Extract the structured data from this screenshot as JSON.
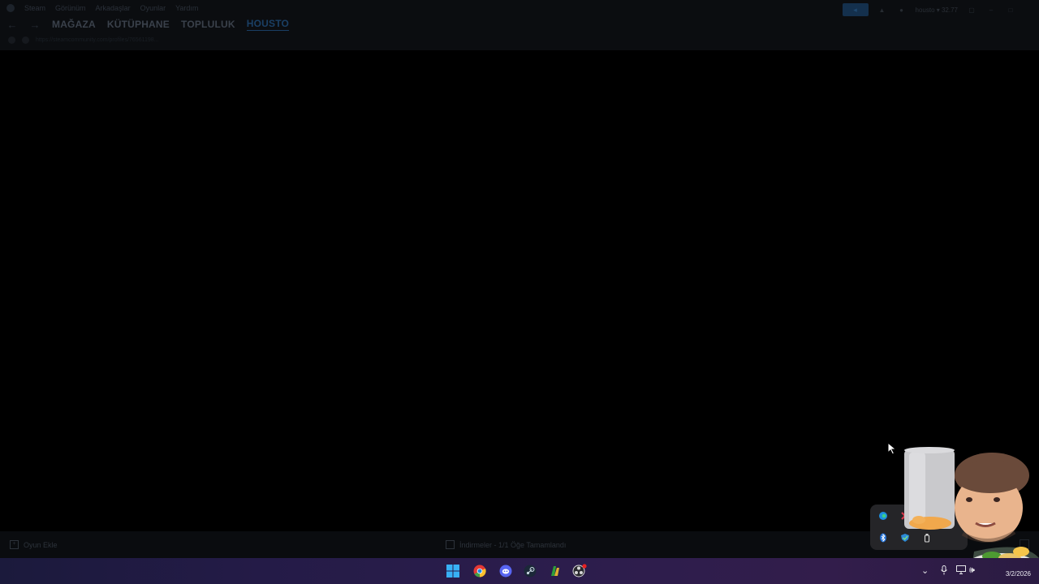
{
  "steam": {
    "menu": [
      "Steam",
      "Görünüm",
      "Arkadaşlar",
      "Oyunlar",
      "Yardım"
    ],
    "nav_tabs": [
      {
        "label": "MAĞAZA"
      },
      {
        "label": "KÜTÜPHANE"
      },
      {
        "label": "TOPLULUK"
      },
      {
        "label": "HOUSTO",
        "active": true
      }
    ],
    "url": "https://steamcommunity.com/profiles/76561198...",
    "account_label": "housto ▾ 32.77",
    "footer": {
      "add_game": "Oyun Ekle",
      "downloads": "İndirmeler - 1/1 Öğe Tamamlandı"
    }
  },
  "tray_popup": {
    "icons": [
      "edge-icon",
      "red-app-icon",
      "bluetooth-icon",
      "defender-icon",
      "usb-icon"
    ]
  },
  "taskbar": {
    "apps": [
      "windows-start-icon",
      "chrome-icon",
      "discord-icon",
      "steam-icon",
      "green-app-icon",
      "obs-icon"
    ],
    "date": "3/2/2026"
  },
  "colors": {
    "taskbar_gradient_start": "#1b1a3c",
    "taskbar_gradient_end": "#321d4b",
    "active_tab": "#1a3f64"
  }
}
